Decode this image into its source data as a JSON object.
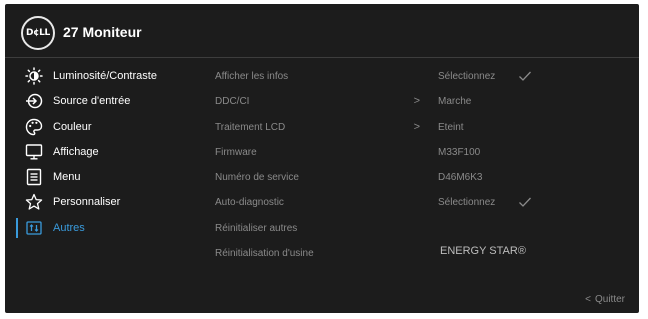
{
  "brand": {
    "logo_text": "D¢LL"
  },
  "header": {
    "title": "27 Moniteur"
  },
  "nav": {
    "items": [
      {
        "label": "Luminosité/Contraste",
        "icon": "brightness-icon"
      },
      {
        "label": "Source d'entrée",
        "icon": "input-source-icon"
      },
      {
        "label": "Couleur",
        "icon": "color-palette-icon"
      },
      {
        "label": "Affichage",
        "icon": "display-icon"
      },
      {
        "label": "Menu",
        "icon": "menu-icon"
      },
      {
        "label": "Personnaliser",
        "icon": "star-icon"
      },
      {
        "label": "Autres",
        "icon": "others-icon",
        "active": true
      }
    ]
  },
  "others": {
    "rows": [
      {
        "label": "Afficher les infos",
        "value": "Sélectionnez",
        "check": true
      },
      {
        "label": "DDC/CI",
        "value": "Marche",
        "submenu": true
      },
      {
        "label": "Traitement LCD",
        "value": "Eteint",
        "submenu": true
      },
      {
        "label": "Firmware",
        "value": "M33F100"
      },
      {
        "label": "Numéro de service",
        "value": "D46M6K3"
      },
      {
        "label": "Auto-diagnostic",
        "value": "Sélectionnez",
        "check": true
      },
      {
        "label": "Réinitialiser autres",
        "value": ""
      },
      {
        "label": "Réinitialisation d'usine",
        "value": "ENERGY STAR®"
      }
    ],
    "chevron": ">"
  },
  "footer": {
    "quit_label": "Quitter",
    "quit_icon": "<"
  },
  "colors": {
    "background": "#1c1c1c",
    "accent": "#3a9bdc",
    "text_primary": "#ffffff",
    "text_dim": "#8a8a8a"
  }
}
